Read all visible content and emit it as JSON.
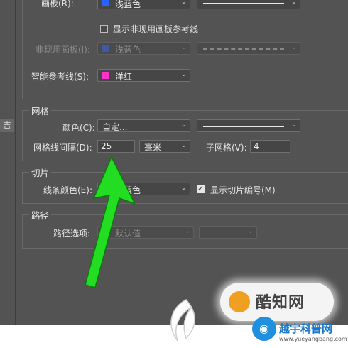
{
  "side_tab": "吉",
  "artboard_row": {
    "label": "画板(R):",
    "color": "浅蓝色",
    "swatch": "#2962ff"
  },
  "show_inactive": {
    "label": "显示非现用画板参考线",
    "checked": false
  },
  "inactive_row": {
    "label": "非现用画板(I):",
    "color": "浅蓝色",
    "swatch": "#3a5fd0"
  },
  "smart_row": {
    "label": "智能参考线(S):",
    "color": "洋红",
    "swatch": "#ff33cc"
  },
  "grid": {
    "title": "网格",
    "color_label": "颜色(C):",
    "color_value": "自定...",
    "spacing_label": "网格线间隔(D):",
    "spacing_value": "25",
    "unit_value": "毫米",
    "subdiv_label": "子网格(V):",
    "subdiv_value": "4"
  },
  "slice": {
    "title": "切片",
    "color_label": "线条颜色(E):",
    "color_value": "浅蓝色",
    "swatch": "#2962ff",
    "show_numbers": {
      "label": "显示切片编号(M)",
      "checked": true
    }
  },
  "path": {
    "title": "路径",
    "options_label": "路径选项:",
    "options_value": "默认值",
    "swatch": "#2a64e0"
  },
  "watermark": {
    "badge_text": "酷知网",
    "brand_text": "越宇科普网",
    "brand_url": "www.yueyangbang.com"
  },
  "colors": {
    "arrow": "#22dd22",
    "panel_bg": "#535353"
  }
}
